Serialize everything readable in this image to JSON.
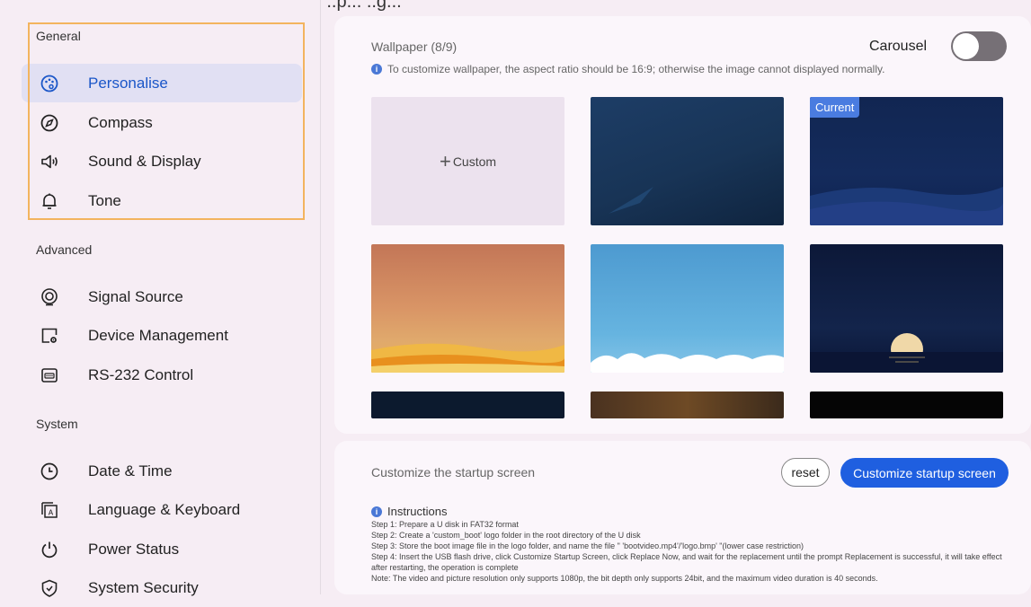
{
  "top_cut_text": "g... ..p... ..g...",
  "sidebar": {
    "sections": [
      {
        "title": "General",
        "items": [
          {
            "label": "Personalise",
            "icon": "palette-icon",
            "active": true
          },
          {
            "label": "Compass",
            "icon": "compass-icon"
          },
          {
            "label": "Sound & Display",
            "icon": "speaker-icon"
          },
          {
            "label": "Tone",
            "icon": "bell-icon"
          }
        ]
      },
      {
        "title": "Advanced",
        "items": [
          {
            "label": "Signal Source",
            "icon": "signal-source-icon"
          },
          {
            "label": "Device Management",
            "icon": "device-management-icon"
          },
          {
            "label": "RS-232 Control",
            "icon": "keyboard-port-icon"
          }
        ]
      },
      {
        "title": "System",
        "items": [
          {
            "label": "Date & Time",
            "icon": "clock-icon"
          },
          {
            "label": "Language & Keyboard",
            "icon": "language-icon"
          },
          {
            "label": "Power Status",
            "icon": "power-icon"
          },
          {
            "label": "System Security",
            "icon": "shield-icon"
          }
        ]
      }
    ]
  },
  "wallpaper": {
    "title": "Wallpaper (8/9)",
    "info": "To customize wallpaper, the aspect ratio should be 16:9; otherwise the image cannot displayed normally.",
    "carousel_label": "Carousel",
    "carousel_on": false,
    "custom_tile_label": "Custom",
    "current_badge": "Current"
  },
  "startup": {
    "title": "Customize the startup screen",
    "reset_label": "reset",
    "customize_label": "Customize startup screen",
    "instructions_title": "Instructions",
    "steps": [
      "Step 1: Prepare a U disk in FAT32 format",
      "Step 2: Create a 'custom_boot' logo folder in the root directory of the U disk",
      "Step 3: Store the boot image file in the logo folder, and name the file \" 'bootvideo.mp4'/'logo.bmp' \"(lower case restriction)",
      "Step 4: Insert the USB flash drive, click Customize Startup Screen, click Replace Now, and wait for the replacement until the prompt Replacement is successful, it will take effect after restarting, the operation is complete",
      "Note: The video and picture resolution only supports 1080p, the bit depth only supports 24bit, and the maximum video duration is 40 seconds."
    ]
  },
  "colors": {
    "accent": "#1f5fe0",
    "active_bg": "#e1e0f3",
    "highlight": "#f3b45e",
    "page_bg": "#f6edf4"
  }
}
